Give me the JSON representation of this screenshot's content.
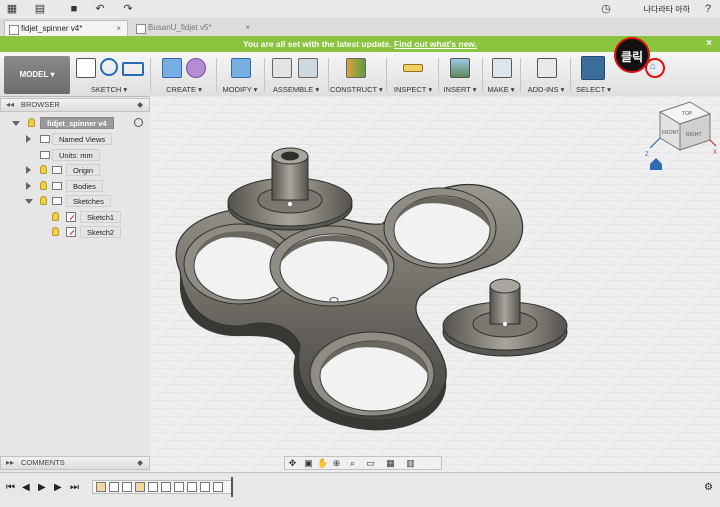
{
  "topbar": {
    "user_name": "나다라타 아하",
    "icons": [
      "grid-icon",
      "file-icon",
      "save-icon",
      "undo-icon",
      "redo-icon",
      "clock-icon",
      "help-icon"
    ]
  },
  "tabs": [
    {
      "label": "fidjet_spinner v4*",
      "close": "×",
      "active": true
    },
    {
      "label": "BusanU_fidjet v5*",
      "close": "×",
      "active": false
    }
  ],
  "banner": {
    "text": "You are all set with the latest update.",
    "link": "Find out what's new.",
    "close": "×"
  },
  "toolbar": {
    "workspace": "MODEL",
    "groups": [
      "SKETCH",
      "CREATE",
      "MODIFY",
      "ASSEMBLE",
      "CONSTRUCT",
      "INSPECT",
      "INSERT",
      "MAKE",
      "ADD-INS",
      "SELECT"
    ]
  },
  "browser": {
    "title": "BROWSER",
    "items": [
      {
        "label": "fidjet_spinner v4"
      },
      {
        "label": "Named Views"
      },
      {
        "label": "Units: mm"
      },
      {
        "label": "Origin"
      },
      {
        "label": "Bodies"
      },
      {
        "label": "Sketches"
      },
      {
        "label": "Sketch1"
      },
      {
        "label": "Sketch2"
      }
    ]
  },
  "comments": {
    "title": "COMMENTS"
  },
  "viewcube": {
    "top": "TOP",
    "front": "FRONT",
    "right": "RIGHT",
    "axis_z": "Z",
    "axis_x": "X"
  },
  "annotation": {
    "badge": "클릭"
  },
  "colors": {
    "banner": "#8bc53f",
    "select_active": "#3a6e9a",
    "click_ring": "#dd1111"
  }
}
